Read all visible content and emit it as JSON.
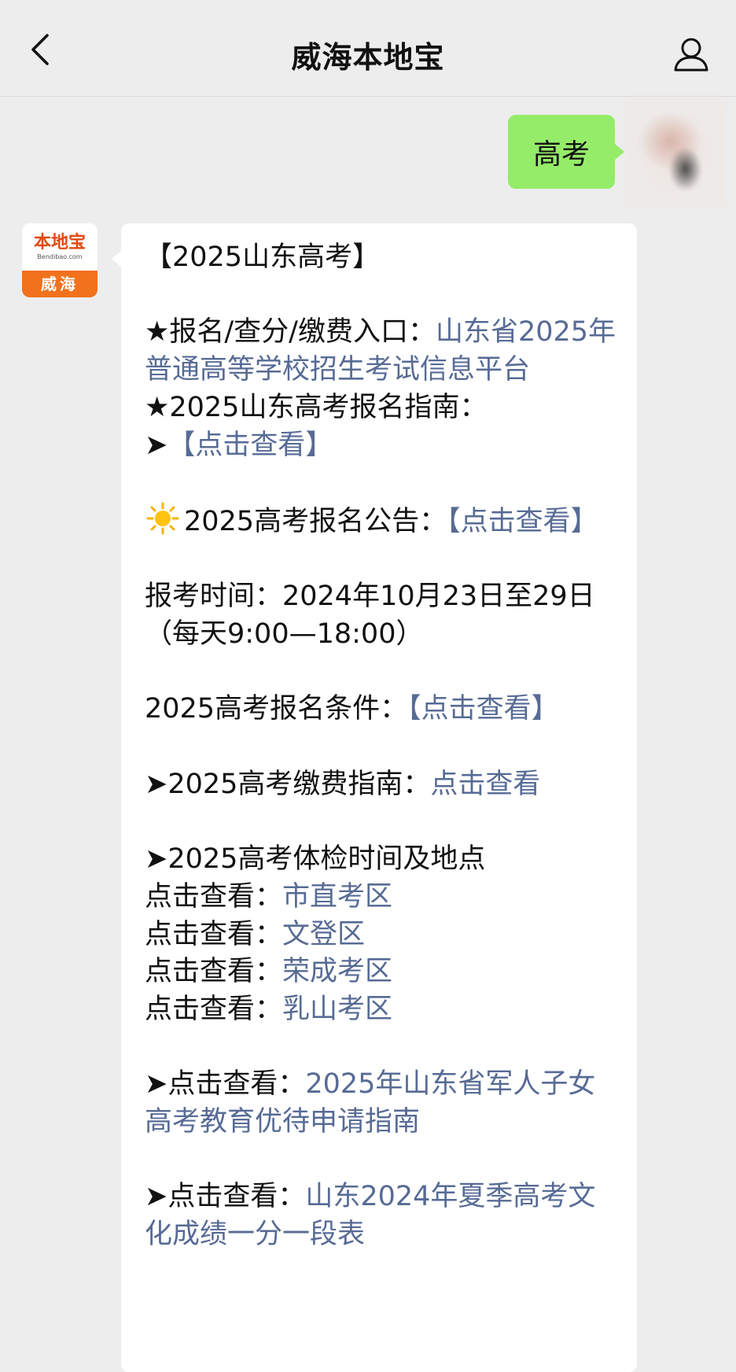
{
  "header": {
    "title": "威海本地宝"
  },
  "chat": {
    "outgoing": {
      "text": "高考"
    },
    "incoming": {
      "avatar": {
        "logo_main": "本地宝",
        "logo_sub": "Bendibao.com",
        "logo_city": "威海"
      },
      "heading": "【2025山东高考】",
      "entry_label": "★报名/查分/缴费入口：",
      "entry_link": "山东省2025年普通高等学校招生考试信息平台",
      "guide_label": "★2025山东高考报名指南：",
      "guide_arrow": "➤",
      "guide_link": "【点击查看】",
      "notice_label": "2025高考报名公告：",
      "notice_link": "【点击查看】",
      "time_text": "报考时间：2024年10月23日至29日（每天9:00—18:00）",
      "condition_label": "2025高考报名条件：",
      "condition_link": "【点击查看】",
      "fee_label": "➤2025高考缴费指南：",
      "fee_link": "点击查看",
      "exam_heading": "➤2025高考体检时间及地点",
      "exam_items": [
        {
          "prefix": "点击查看：",
          "link": "市直考区"
        },
        {
          "prefix": "点击查看：",
          "link": "文登区"
        },
        {
          "prefix": "点击查看：",
          "link": "荣成考区"
        },
        {
          "prefix": "点击查看：",
          "link": "乳山考区"
        }
      ],
      "military_label": "➤点击查看：",
      "military_link": "2025年山东省军人子女高考教育优待申请指南",
      "score_label": "➤点击查看：",
      "score_link": "山东2024年夏季高考文化成绩一分一段表"
    }
  },
  "colors": {
    "background": "#ededed",
    "outgoing_bubble": "#95ec69",
    "incoming_bubble": "#ffffff",
    "link": "#576b95",
    "logo_orange": "#f2711c"
  }
}
